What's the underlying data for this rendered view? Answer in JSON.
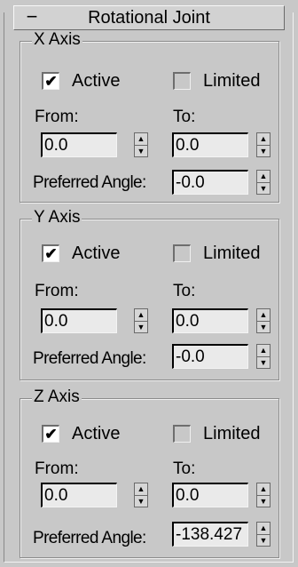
{
  "rollout": {
    "toggle": "−",
    "title": "Rotational Joint"
  },
  "glyphs": {
    "check": "✔",
    "spin_up": "▲",
    "spin_down": "▼"
  },
  "axes": [
    {
      "label": "X Axis",
      "active_label": "Active",
      "active_checked": true,
      "limited_label": "Limited",
      "limited_checked": false,
      "from_label": "From:",
      "to_label": "To:",
      "from_value": "0.0",
      "to_value": "0.0",
      "preferred_label": "Preferred Angle:",
      "preferred_value": "-0.0"
    },
    {
      "label": "Y Axis",
      "active_label": "Active",
      "active_checked": true,
      "limited_label": "Limited",
      "limited_checked": false,
      "from_label": "From:",
      "to_label": "To:",
      "from_value": "0.0",
      "to_value": "0.0",
      "preferred_label": "Preferred Angle:",
      "preferred_value": "-0.0"
    },
    {
      "label": "Z Axis",
      "active_label": "Active",
      "active_checked": true,
      "limited_label": "Limited",
      "limited_checked": false,
      "from_label": "From:",
      "to_label": "To:",
      "from_value": "0.0",
      "to_value": "0.0",
      "preferred_label": "Preferred Angle:",
      "preferred_value": "-138.427"
    }
  ]
}
